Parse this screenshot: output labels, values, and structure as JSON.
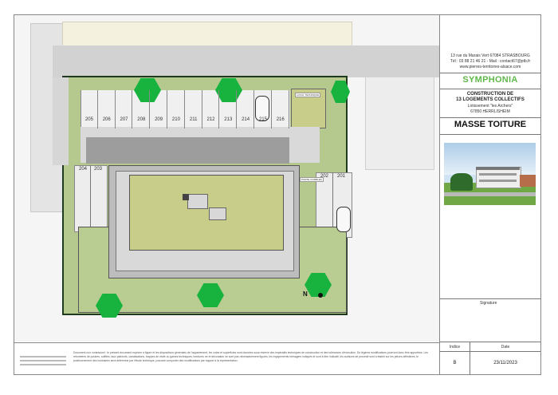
{
  "address": {
    "line1": "13 rue du Marais Vert 67084 STRASBOURG",
    "line2": "Tél : 03 88 21 46 21 - Mail : contact67@ptb.fr",
    "line3": "www.pierres-territoires-alsace.com"
  },
  "project": {
    "name": "SYMPHONIA",
    "title_line1": "CONSTRUCTION DE",
    "title_line2": "13 LOGEMENTS COLLECTIFS",
    "subtitle_line1": "Lotissement \"les Archers\"",
    "subtitle_line2": "67850 HERRLISHEIM",
    "sheet_title": "MASSE TOITURE"
  },
  "signature_label": "Signature",
  "table": {
    "indice_header": "Indice",
    "date_header": "Date",
    "indice_value": "B",
    "date_value": "23/11/2023"
  },
  "colors": {
    "brand_green": "#5fb84a",
    "lawn": "#b5c98e",
    "roof": "#c8cd8a",
    "tree": "#17b33e"
  },
  "parking_top": [
    "205",
    "206",
    "207",
    "208",
    "209",
    "210",
    "211",
    "212",
    "213",
    "214",
    "215",
    "216"
  ],
  "parking_left": [
    "204",
    "203"
  ],
  "parking_right": [
    "202",
    "201"
  ],
  "plan_labels": {
    "local_technique": "LOCAL TECHNIQUE",
    "porte_combles": "PORTE COMBLES",
    "north": "N"
  },
  "disclaimer": "Document non contractuel : le présent document exprime à figure et les dispositions générales de l'appartement, les cotes et superficies sont données sous réserve des impératifs techniques de construction et des tolérances d'exécution. De légères modifications pourront donc être apportées. Les retombées de poutres, soffites, faux plafonds, canalisations, trappes de visite ou gaines techniques, bordures ne et décoration ne sont pas nécessairement figurés, les équipements ménagers indiqués le sont à titre indicatif, les surfaces de procédé sont à établir sur les pièces définitives, le positionnement des luminaires sera déterminé par l'étude technique, pouvant comporter des modifications par rapport à la représentation."
}
